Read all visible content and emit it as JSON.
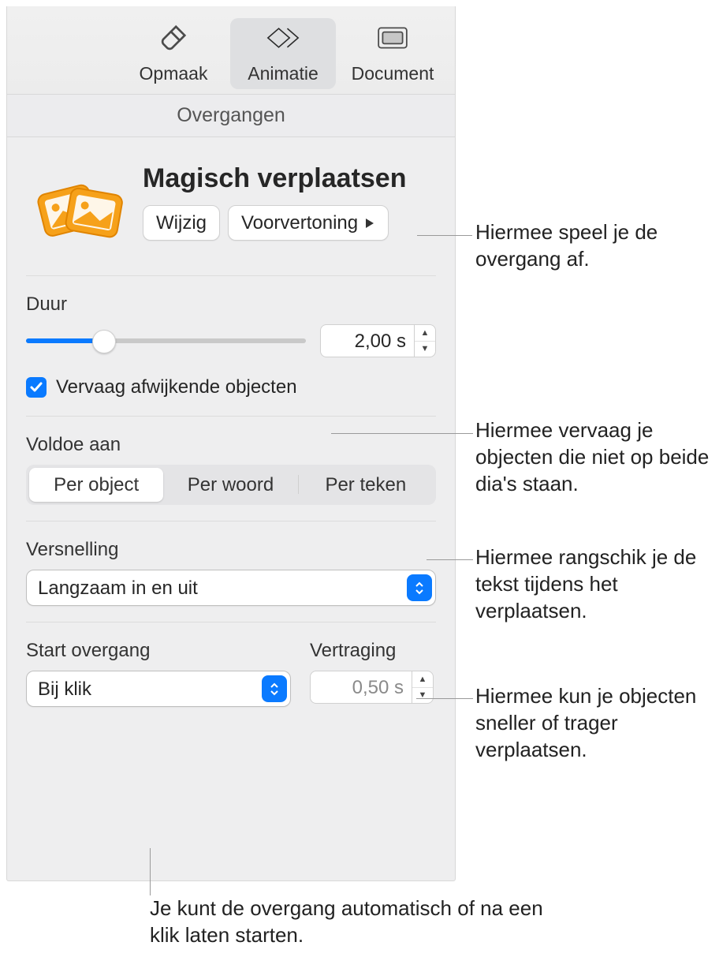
{
  "tabs": {
    "format": "Opmaak",
    "animate": "Animatie",
    "document": "Document"
  },
  "subheader": "Overgangen",
  "title": "Magisch verplaatsen",
  "edit_button": "Wijzig",
  "preview_button": "Voorvertoning",
  "duration": {
    "label": "Duur",
    "value": "2,00 s",
    "slider_percent": 28
  },
  "fade_checkbox": {
    "label": "Vervaag afwijkende objecten",
    "checked": true
  },
  "match": {
    "label": "Voldoe aan",
    "options": [
      "Per object",
      "Per woord",
      "Per teken"
    ],
    "selected_index": 0
  },
  "acceleration": {
    "label": "Versnelling",
    "value": "Langzaam in en uit"
  },
  "start": {
    "label": "Start overgang",
    "value": "Bij klik"
  },
  "delay": {
    "label": "Vertraging",
    "value": "0,50 s"
  },
  "callouts": {
    "preview": "Hiermee speel je de overgang af.",
    "fade": "Hiermee vervaag je objecten die niet op beide dia's staan.",
    "match": "Hiermee rangschik je de tekst tijdens het verplaatsen.",
    "accel": "Hiermee kun je objecten sneller of trager verplaatsen.",
    "start": "Je kunt de overgang automatisch of na een klik laten starten."
  }
}
